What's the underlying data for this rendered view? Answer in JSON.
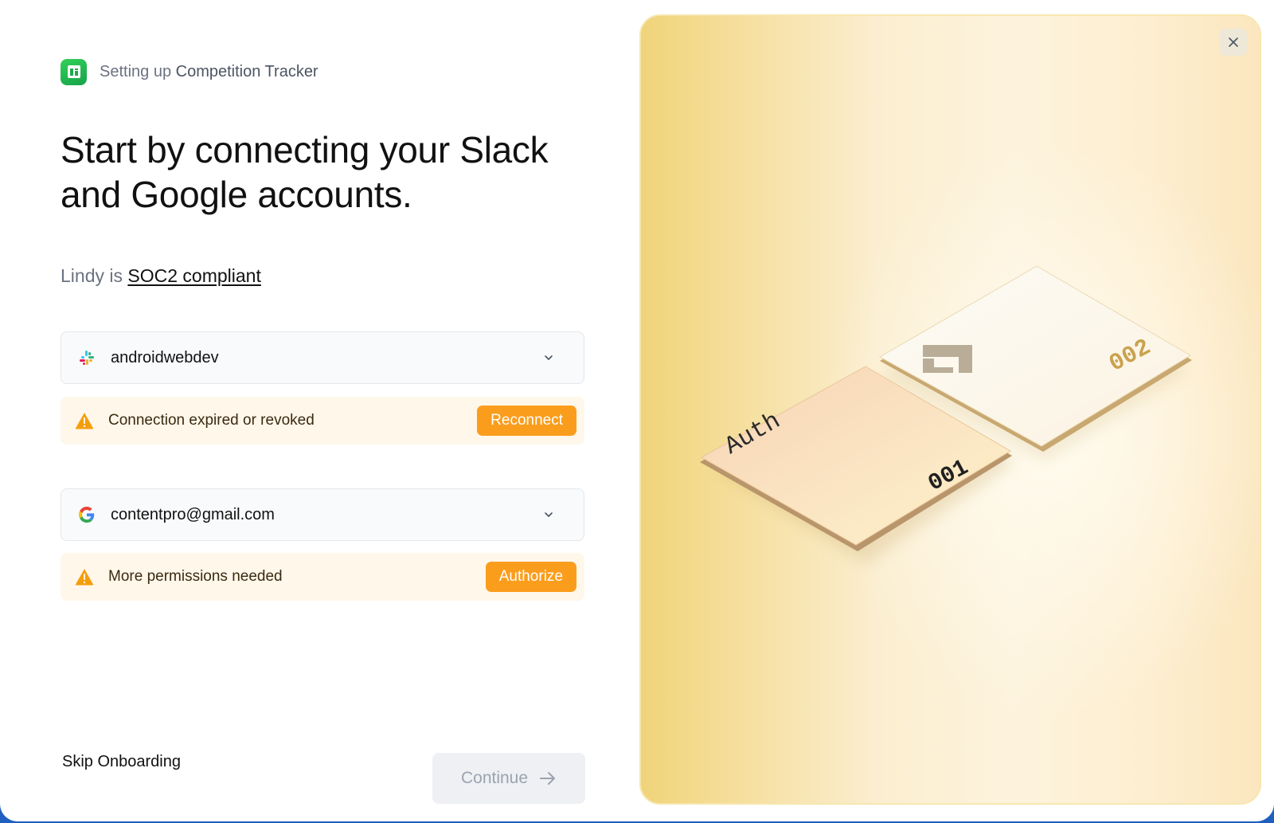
{
  "header": {
    "prefix": "Setting up",
    "app_name": "Competition Tracker"
  },
  "headline": "Start by connecting your Slack and Google accounts.",
  "compliance": {
    "prefix": "Lindy is",
    "link": "SOC2 compliant"
  },
  "accounts": [
    {
      "service": "Slack",
      "icon": "slack-icon",
      "label": "androidwebdev",
      "alert": {
        "icon": "warning-icon",
        "message": "Connection expired or revoked",
        "action": "Reconnect"
      }
    },
    {
      "service": "Google",
      "icon": "google-icon",
      "label": "contentpro@gmail.com",
      "alert": {
        "icon": "warning-icon",
        "message": "More permissions needed",
        "action": "Authorize"
      }
    }
  ],
  "footer": {
    "skip": "Skip Onboarding",
    "continue": "Continue"
  },
  "illustration": {
    "tile_1_label": "Auth",
    "tile_1_number": "001",
    "tile_2_number": "002"
  },
  "colors": {
    "accent_orange": "#fb9d1c",
    "alert_bg": "#fff7ea",
    "logo_green": "#22c55e",
    "panel_gold": "#f0d47a"
  }
}
